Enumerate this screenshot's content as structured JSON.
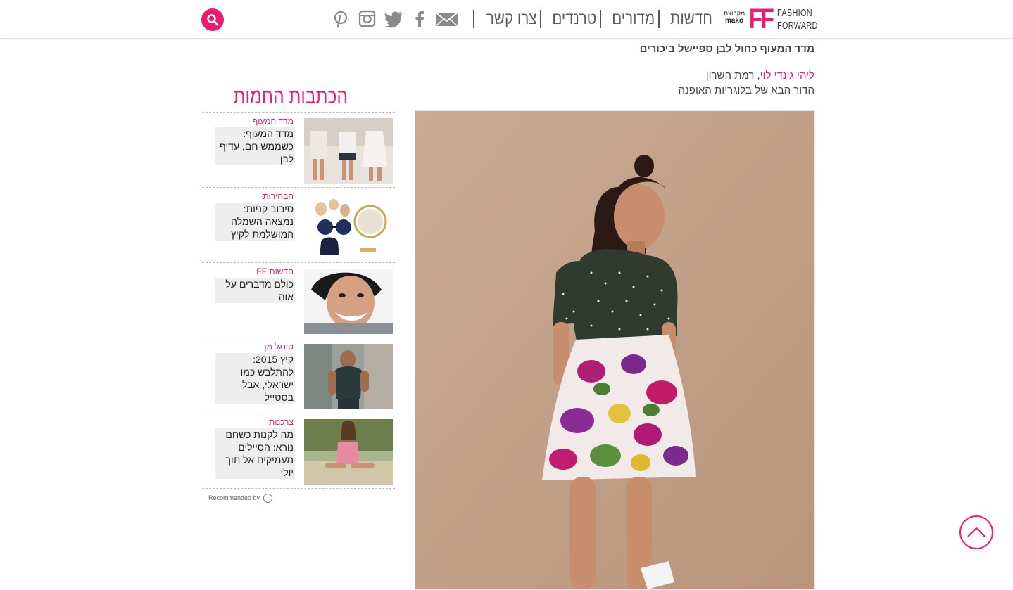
{
  "header": {
    "logo": {
      "ff": "FF",
      "line1": "FASHION",
      "line2": "FORWARD",
      "group_label": "מקבוצת",
      "group_brand": "mako"
    },
    "nav": [
      {
        "label": "חדשות"
      },
      {
        "label": "מדורים"
      },
      {
        "label": "טרנדים"
      },
      {
        "label": "צרו קשר"
      }
    ],
    "social_icons": [
      "envelope-icon",
      "facebook-icon",
      "twitter-icon",
      "instagram-icon",
      "pinterest-icon"
    ],
    "search_icon": "search-icon"
  },
  "article": {
    "title": "מדד המעוף כחול לבן ספיישל ביכורים",
    "author_name": "ליהי גינדי לוי",
    "author_location": ", רמת השרון",
    "author_desc": "הדור הבא של בלוגריות האופנה"
  },
  "sidebar": {
    "title": "הכתבות החמות",
    "items": [
      {
        "category": "מדד המעוף",
        "title": "מדד המעוף: כשממש חם, עדיף לבן"
      },
      {
        "category": "הבחירות",
        "title": "סיבוב קניות: נמצאה השמלה המושלמת לקיץ"
      },
      {
        "category": "חדשות FF",
        "title": "כולם מדברים על אוה"
      },
      {
        "category": "סינגל מן",
        "title": "קיץ 2015: להתלבש כמו ישראלי, אבל בסטייל"
      },
      {
        "category": "צרכנות",
        "title": "מה לקנות כשחם נורא: הסיילים מעמיקים אל תוך יולי"
      }
    ],
    "recommended_by": "Recommended by"
  },
  "colors": {
    "accent": "#ec1c73",
    "text": "#444444",
    "nav": "#5a5a5a"
  }
}
